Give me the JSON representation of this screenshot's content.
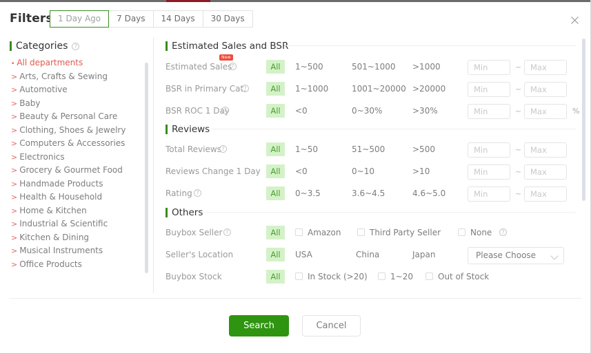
{
  "header": {
    "title": "Filters",
    "close_icon": "close-icon",
    "tabs": [
      {
        "label": "1 Day Ago",
        "active": true
      },
      {
        "label": "7 Days",
        "active": false
      },
      {
        "label": "14 Days",
        "active": false
      },
      {
        "label": "30 Days",
        "active": false
      }
    ]
  },
  "categories": {
    "title": "Categories",
    "help_icon": "help-circle-icon",
    "items": [
      {
        "label": "All departments",
        "selected": true
      },
      {
        "label": "Arts, Crafts & Sewing",
        "selected": false
      },
      {
        "label": "Automotive",
        "selected": false
      },
      {
        "label": "Baby",
        "selected": false
      },
      {
        "label": "Beauty & Personal Care",
        "selected": false
      },
      {
        "label": "Clothing, Shoes & Jewelry",
        "selected": false
      },
      {
        "label": "Computers & Accessories",
        "selected": false
      },
      {
        "label": "Electronics",
        "selected": false
      },
      {
        "label": "Grocery & Gourmet Food",
        "selected": false
      },
      {
        "label": "Handmade Products",
        "selected": false
      },
      {
        "label": "Health & Household",
        "selected": false
      },
      {
        "label": "Home & Kitchen",
        "selected": false
      },
      {
        "label": "Industrial & Scientific",
        "selected": false
      },
      {
        "label": "Kitchen & Dining",
        "selected": false
      },
      {
        "label": "Musical Instruments",
        "selected": false
      },
      {
        "label": "Office Products",
        "selected": false
      }
    ]
  },
  "sections": {
    "estimated": {
      "title": "Estimated Sales and BSR",
      "rows": {
        "estimated_sales": {
          "label": "Estimated Sales",
          "badge": "New",
          "all": "All",
          "opt1": "1~500",
          "opt2": "501~1000",
          "opt3": ">1000",
          "min_placeholder": "Min",
          "max_placeholder": "Max",
          "tilde": "~"
        },
        "bsr_primary": {
          "label": "BSR in Primary Cat.",
          "all": "All",
          "opt1": "1~1000",
          "opt2": "1001~20000",
          "opt3": ">20000",
          "min_placeholder": "Min",
          "max_placeholder": "Max",
          "tilde": "~"
        },
        "bsr_roc": {
          "label": "BSR ROC 1 Day",
          "all": "All",
          "opt1": "<0",
          "opt2": "0~30%",
          "opt3": ">30%",
          "min_placeholder": "Min",
          "max_placeholder": "Max",
          "tilde": "~",
          "unit": "%"
        }
      }
    },
    "reviews": {
      "title": "Reviews",
      "rows": {
        "total_reviews": {
          "label": "Total Reviews",
          "all": "All",
          "opt1": "1~50",
          "opt2": "51~500",
          "opt3": ">500",
          "min_placeholder": "Min",
          "max_placeholder": "Max",
          "tilde": "~"
        },
        "reviews_change": {
          "label": "Reviews Change 1 Day",
          "all": "All",
          "opt1": "<0",
          "opt2": "0~10",
          "opt3": ">10",
          "min_placeholder": "Min",
          "max_placeholder": "Max",
          "tilde": "~"
        },
        "rating": {
          "label": "Rating",
          "all": "All",
          "opt1": "0~3.5",
          "opt2": "3.6~4.5",
          "opt3": "4.6~5.0",
          "min_placeholder": "Min",
          "max_placeholder": "Max",
          "tilde": "~"
        }
      }
    },
    "others": {
      "title": "Others",
      "rows": {
        "buybox_seller": {
          "label": "Buybox Seller",
          "all": "All",
          "opt1": "Amazon",
          "opt2": "Third Party Seller",
          "opt3": "None"
        },
        "sellers_location": {
          "label": "Seller's Location",
          "all": "All",
          "opt1": "USA",
          "opt2": "China",
          "opt3": "Japan",
          "select_value": "Please Choose"
        },
        "buybox_stock": {
          "label": "Buybox Stock",
          "all": "All",
          "opt1": "In Stock (>20)",
          "opt2": "1~20",
          "opt3": "Out of Stock"
        }
      }
    }
  },
  "footer": {
    "search_label": "Search",
    "cancel_label": "Cancel"
  },
  "colors": {
    "accent_green": "#2f9410",
    "chip_green_bg": "#d4f2c8",
    "chip_green_text": "#4d9b32",
    "selected_red": "#e05a4f",
    "badge_red": "#ee4b3c"
  }
}
